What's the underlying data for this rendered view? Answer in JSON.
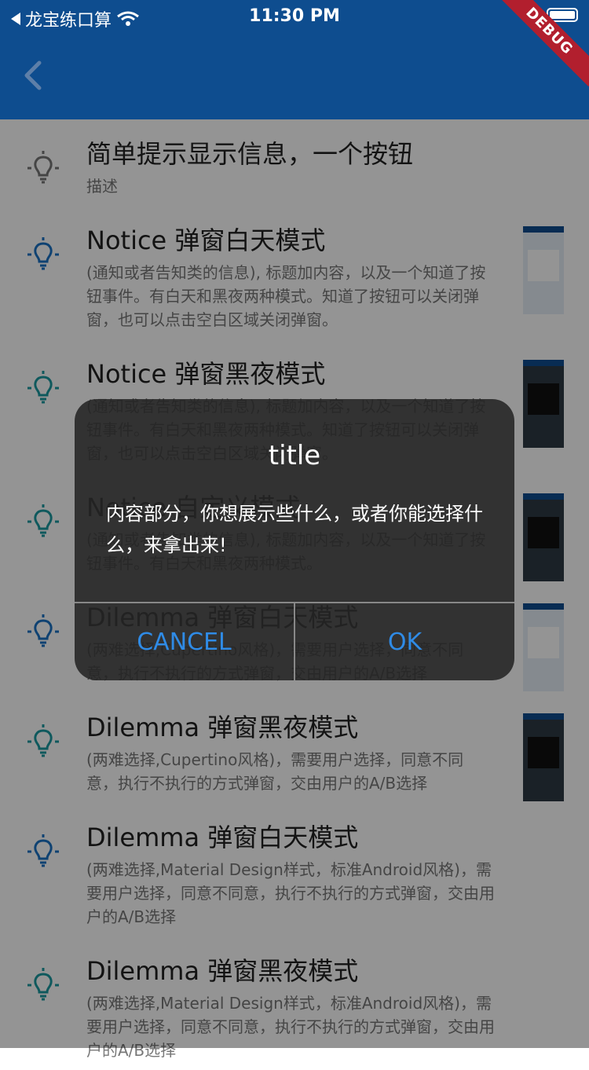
{
  "status_bar": {
    "carrier": "龙宝练口算",
    "time": "11:30 PM"
  },
  "debug_banner": "DEBUG",
  "items": [
    {
      "title": "简单提示显示信息，一个按钮",
      "desc": "描述",
      "icon_color": "#777777",
      "thumb": "none"
    },
    {
      "title": "Notice 弹窗白天模式",
      "desc": "(通知或者告知类的信息), 标题加内容，以及一个知道了按钮事件。有白天和黑夜两种模式。知道了按钮可以关闭弹窗，也可以点击空白区域关闭弹窗。",
      "icon_color": "#1a73c4",
      "thumb": "light"
    },
    {
      "title": "Notice 弹窗黑夜模式",
      "desc": "(通知或者告知类的信息), 标题加内容，以及一个知道了按钮事件。有白天和黑夜两种模式。知道了按钮可以关闭弹窗，也可以点击空白区域关闭弹窗。",
      "icon_color": "#1a9aa0",
      "thumb": "dark"
    },
    {
      "title": "Notice 自定义模式",
      "desc": "(通知或者告知类的信息), 标题加内容，以及一个知道了按钮事件。有白天和黑夜两种模式。",
      "icon_color": "#1a9aa0",
      "thumb": "dark"
    },
    {
      "title": "Dilemma 弹窗白天模式",
      "desc": "(两难选择,Cupertino风格)，需要用户选择，同意不同意，执行不执行的方式弹窗，交由用户的A/B选择",
      "icon_color": "#1a73c4",
      "thumb": "light"
    },
    {
      "title": "Dilemma 弹窗黑夜模式",
      "desc": "(两难选择,Cupertino风格)，需要用户选择，同意不同意，执行不执行的方式弹窗，交由用户的A/B选择",
      "icon_color": "#1a9aa0",
      "thumb": "dark"
    },
    {
      "title": "Dilemma 弹窗白天模式",
      "desc": "(两难选择,Material Design样式，标准Android风格)，需要用户选择，同意不同意，执行不执行的方式弹窗，交由用户的A/B选择",
      "icon_color": "#1a73c4",
      "thumb": "none"
    },
    {
      "title": "Dilemma 弹窗黑夜模式",
      "desc": "(两难选择,Material Design样式，标准Android风格)，需要用户选择，同意不同意，执行不执行的方式弹窗，交由用户的A/B选择",
      "icon_color": "#1a9aa0",
      "thumb": "none"
    }
  ],
  "dialog": {
    "title": "title",
    "content": "内容部分，你想展示些什么，或者你能选择什么，来拿出来!",
    "cancel_label": "CANCEL",
    "ok_label": "OK"
  }
}
